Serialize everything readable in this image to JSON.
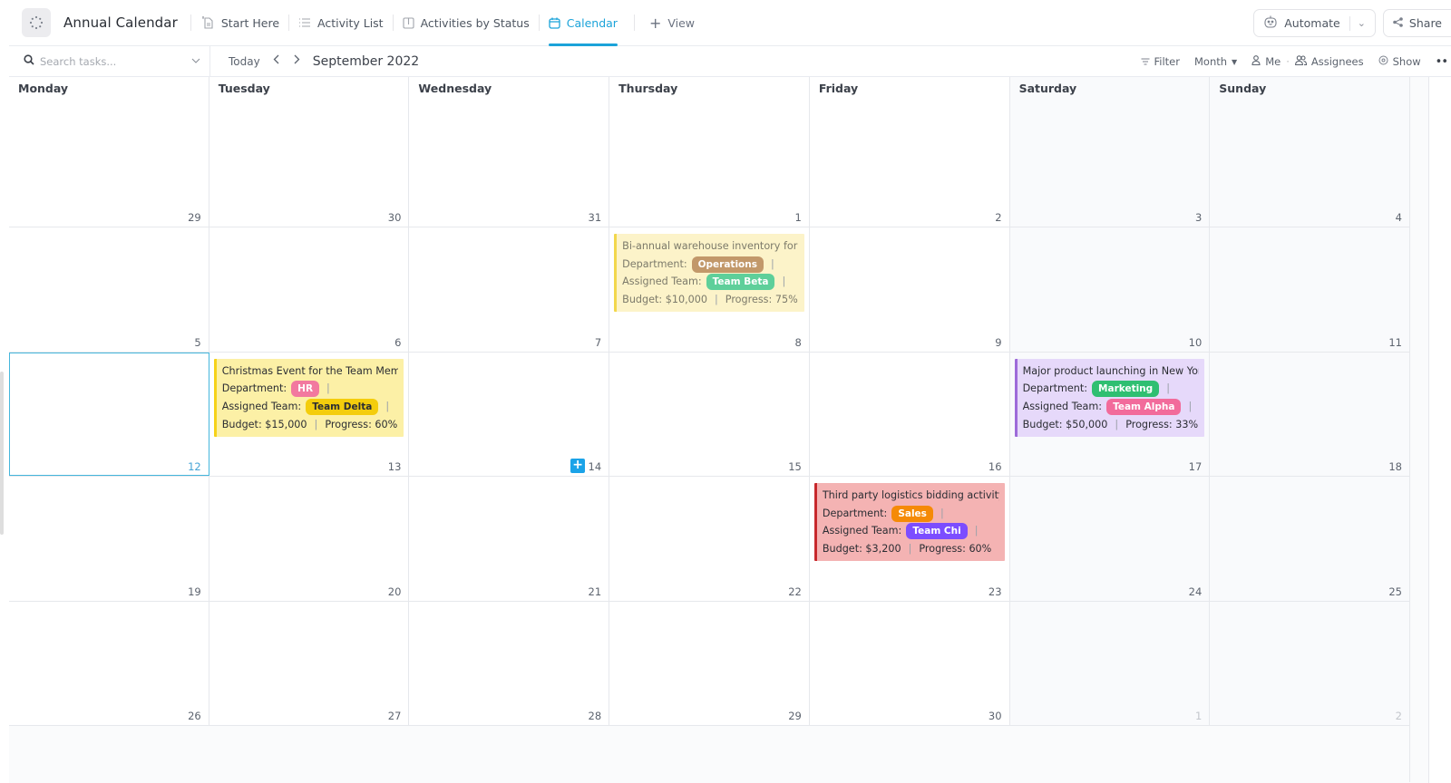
{
  "header": {
    "space_icon": "spinner-dots-icon",
    "title": "Annual Calendar",
    "views": [
      {
        "label": "Start Here",
        "icon": "doc-pin-icon",
        "active": false
      },
      {
        "label": "Activity List",
        "icon": "list-icon",
        "active": false
      },
      {
        "label": "Activities by Status",
        "icon": "board-icon",
        "active": false
      },
      {
        "label": "Calendar",
        "icon": "calendar-icon",
        "active": true
      }
    ],
    "add_view_label": "View",
    "automate_label": "Automate",
    "share_label": "Share"
  },
  "toolbar": {
    "search_placeholder": "Search tasks...",
    "today_label": "Today",
    "month_label": "September 2022",
    "filter_label": "Filter",
    "range_label": "Month",
    "me_label": "Me",
    "assignees_label": "Assignees",
    "show_label": "Show"
  },
  "calendar": {
    "weekdays": [
      "Monday",
      "Tuesday",
      "Wednesday",
      "Thursday",
      "Friday",
      "Saturday",
      "Sunday"
    ],
    "weeks": [
      [
        {
          "d": "29",
          "other": false
        },
        {
          "d": "30"
        },
        {
          "d": "31"
        },
        {
          "d": "1"
        },
        {
          "d": "2"
        },
        {
          "d": "3"
        },
        {
          "d": "4"
        }
      ],
      [
        {
          "d": "5"
        },
        {
          "d": "6"
        },
        {
          "d": "7"
        },
        {
          "d": "8"
        },
        {
          "d": "9"
        },
        {
          "d": "10"
        },
        {
          "d": "11"
        }
      ],
      [
        {
          "d": "12",
          "selected": true
        },
        {
          "d": "13"
        },
        {
          "d": "14",
          "hover_add": true
        },
        {
          "d": "15"
        },
        {
          "d": "16"
        },
        {
          "d": "17"
        },
        {
          "d": "18"
        }
      ],
      [
        {
          "d": "19"
        },
        {
          "d": "20"
        },
        {
          "d": "21"
        },
        {
          "d": "22"
        },
        {
          "d": "23"
        },
        {
          "d": "24"
        },
        {
          "d": "25"
        }
      ],
      [
        {
          "d": "26"
        },
        {
          "d": "27"
        },
        {
          "d": "28"
        },
        {
          "d": "29"
        },
        {
          "d": "30"
        },
        {
          "d": "1",
          "other": true
        },
        {
          "d": "2",
          "other": true
        }
      ]
    ],
    "labels": {
      "department": "Department:",
      "team": "Assigned Team:",
      "budget": "Budget:",
      "progress": "Progress:"
    },
    "events": [
      {
        "week": 1,
        "day": 3,
        "style": "ev-yellow-muted",
        "title": "Bi-annual warehouse inventory for spare parts",
        "department": "Operations",
        "department_color": "#c2986a",
        "team": "Team Beta",
        "team_color": "#5ecf9a",
        "budget": "$10,000",
        "progress": "75%"
      },
      {
        "week": 2,
        "day": 1,
        "style": "ev-yellow",
        "title": "Christmas Event for the Team Members",
        "department": "HR",
        "department_color": "#f2799f",
        "team": "Team Delta",
        "team_color": "#f4cd0c",
        "team_text_color": "#2b2d33",
        "budget": "$15,000",
        "progress": "60%"
      },
      {
        "week": 2,
        "day": 5,
        "style": "ev-purple",
        "title": "Major product launching in New York City",
        "department": "Marketing",
        "department_color": "#2fbf71",
        "team": "Team Alpha",
        "team_color": "#f26b9b",
        "budget": "$50,000",
        "progress": "33%"
      },
      {
        "week": 3,
        "day": 4,
        "style": "ev-red",
        "title": "Third party logistics bidding activity",
        "department": "Sales",
        "department_color": "#f58a07",
        "team": "Team Chi",
        "team_color": "#7c4dff",
        "budget": "$3,200",
        "progress": "60%"
      }
    ]
  },
  "colors": {
    "accent": "#1ba3d9"
  }
}
